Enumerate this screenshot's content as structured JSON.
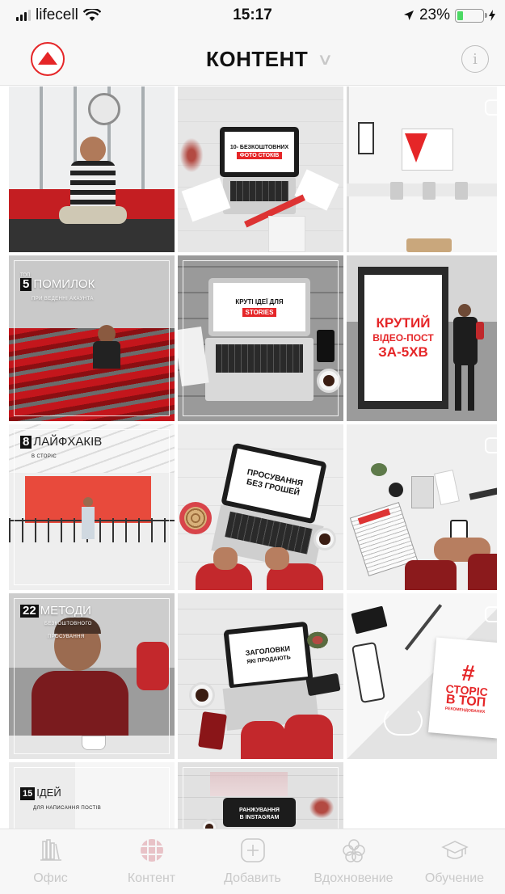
{
  "status_bar": {
    "carrier": "lifecell",
    "time": "15:17",
    "battery": "23%",
    "battery_level": 0.23
  },
  "header": {
    "title": "КОНТЕНТ"
  },
  "posts": [
    {
      "id": "p1"
    },
    {
      "id": "p2",
      "screen_line1": "10- БЕЗКОШТОВНИХ",
      "screen_line2": "ФОТО СТОКІВ"
    },
    {
      "id": "p3"
    },
    {
      "id": "p4",
      "top": "ТОП",
      "num": "5",
      "title": "ПОМИЛОК",
      "sub": "ПРИ ВЕДЕННІ АКАУНТА"
    },
    {
      "id": "p5",
      "screen_line1": "КРУТІ ІДЕЇ ДЛЯ",
      "screen_line2": "STORIES"
    },
    {
      "id": "p6",
      "line1": "КРУТИЙ",
      "line2": "ВІДЕО-ПОСТ",
      "line3": "ЗА-5ХВ"
    },
    {
      "id": "p7",
      "num": "8",
      "title": "ЛАЙФХАКІВ",
      "sub": "В СТОРІС"
    },
    {
      "id": "p8",
      "screen_line1": "ПРОСУВАННЯ",
      "screen_line2": "БЕЗ ГРОШЕЙ"
    },
    {
      "id": "p9"
    },
    {
      "id": "p10",
      "num": "22",
      "title": "МЕТОДИ",
      "sub1": "БЕЗКОШТОВНОГО",
      "sub2": "ПРОСУВАННЯ"
    },
    {
      "id": "p11",
      "screen_line1": "ЗАГОЛОВКИ",
      "screen_line2": "ЯКІ ПРОДАЮТЬ"
    },
    {
      "id": "p12",
      "hash": "#",
      "line1": "СТОРІС",
      "line2": "В ТОП",
      "line3": "РЕКОМЕНДОВАНИХ"
    },
    {
      "id": "p13",
      "num": "15",
      "title": "ІДЕЙ",
      "sub": "ДЛЯ НАПИСАННЯ ПОСТІВ"
    },
    {
      "id": "p14",
      "screen_line1": "РАНЖУВАННЯ",
      "screen_line2": "В INSTAGRAM"
    }
  ],
  "tabs": [
    {
      "label": "Офис",
      "icon": "books-icon"
    },
    {
      "label": "Контент",
      "icon": "grid-icon",
      "active": true
    },
    {
      "label": "Добавить",
      "icon": "plus-icon"
    },
    {
      "label": "Вдохновение",
      "icon": "flower-icon"
    },
    {
      "label": "Обучение",
      "icon": "graduation-cap-icon"
    }
  ],
  "colors": {
    "accent": "#e52628",
    "tab_active": "#e8c2c7",
    "tab_inactive": "#c9c9c9"
  }
}
